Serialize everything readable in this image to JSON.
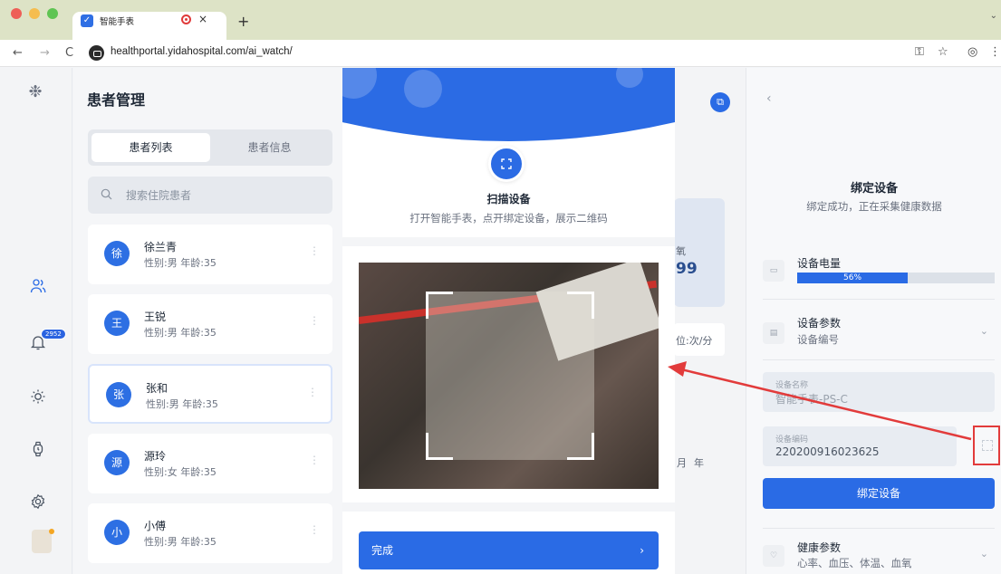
{
  "browser": {
    "tab_title": "智能手表",
    "tab_close": "×",
    "new_tab": "+",
    "url": "healthportal.yidahospital.com/ai_watch/",
    "back": "←",
    "forward": "→",
    "reload": "C"
  },
  "sidebar": {
    "notification_count": "2952"
  },
  "patient_panel": {
    "title": "患者管理",
    "tabs": [
      {
        "label": "患者列表"
      },
      {
        "label": "患者信息"
      }
    ],
    "search_placeholder": "搜索住院患者",
    "patients": [
      {
        "avatar": "徐",
        "name": "徐兰青",
        "meta": "性别:男 年龄:35"
      },
      {
        "avatar": "王",
        "name": "王锐",
        "meta": "性别:男 年龄:35"
      },
      {
        "avatar": "张",
        "name": "张和",
        "meta": "性别:男 年龄:35"
      },
      {
        "avatar": "源",
        "name": "源玲",
        "meta": "性别:女 年龄:35"
      },
      {
        "avatar": "小",
        "name": "小傅",
        "meta": "性别:男 年龄:35"
      }
    ]
  },
  "background_fragments": {
    "oxygen": "氧",
    "value_partial": "99",
    "unit_partial": "位:次/分",
    "month": "月",
    "year": "年"
  },
  "scan_modal": {
    "title": "扫描设备",
    "subtitle": "打开智能手表，点开绑定设备，展示二维码",
    "done_label": "完成",
    "done_chevron": "›"
  },
  "right_panel": {
    "title": "绑定设备",
    "subtitle": "绑定成功，正在采集健康数据",
    "battery_label": "设备电量",
    "battery_percent": "56%",
    "battery_value": 0.56,
    "params_label": "设备参数",
    "params_sub": "设备编号",
    "device_name_label": "设备名称",
    "device_name_value": "智能手表-PS-C",
    "device_code_label": "设备编码",
    "device_code_value": "220200916023625",
    "bind_button": "绑定设备",
    "health_label": "健康参数",
    "health_sub": "心率、血压、体温、血氧"
  },
  "colors": {
    "primary": "#2a6be5",
    "annotation_red": "#e23b3b"
  }
}
